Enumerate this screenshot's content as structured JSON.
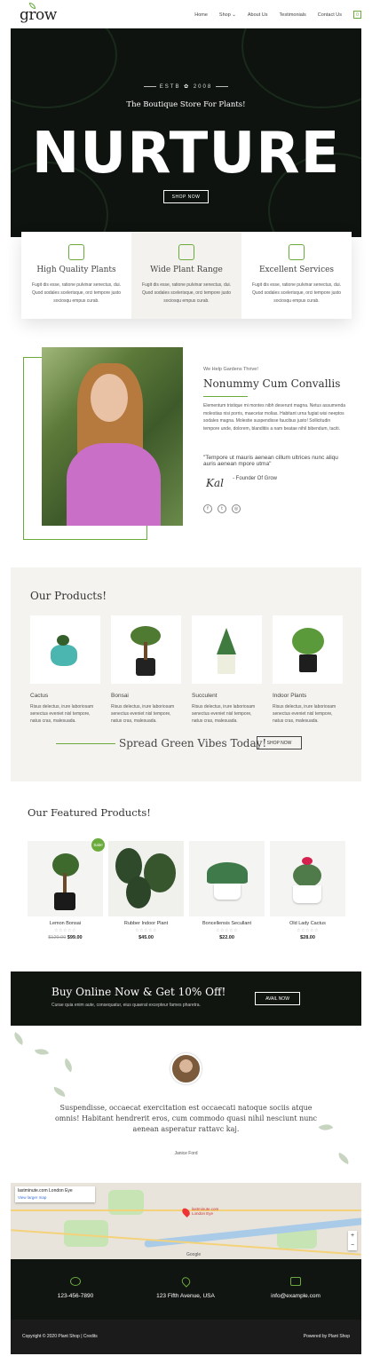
{
  "header": {
    "logo": "grow",
    "nav": [
      "Home",
      "Shop ⌄",
      "About Us",
      "Testimonials",
      "Contact Us"
    ],
    "cart_count": "0"
  },
  "hero": {
    "estb": "ESTB",
    "year": "2008",
    "tagline": "The Boutique Store For Plants!",
    "title": "NURTURE",
    "button": "SHOP NOW"
  },
  "features": [
    {
      "title": "High Quality Plants",
      "text": "Fugit dis esse, ratione pulvinar senectus, dui. Quod sodales scelerisque, orci tempore justo sociosqu empus curab.",
      "icon": "sprout-icon"
    },
    {
      "title": "Wide Plant Range",
      "text": "Fugit dis esse, ratione pulvinar senectus, dui. Quod sodales scelerisque, orci tempore justo sociosqu empus curab.",
      "icon": "cactus-icon"
    },
    {
      "title": "Excellent Services",
      "text": "Fugit dis esse, ratione pulvinar senectus, dui. Quod sodales scelerisque, orci tempore justo sociosqu empus curab.",
      "icon": "house-plant-icon"
    }
  ],
  "about": {
    "subtitle": "We Help Gardens Thrive!",
    "title": "Nonummy Cum Convallis",
    "text": "Elementum tristique mi montes nibh deserunt magna. Netus assumenda molestias nisi porris, maecetar molias. Habitant urna fugiat wisi neeptos sodales magna. Molestie suspendisse faucibus justo! Sollicitudin tempore unde, dolorem, blanditiis a nam beatae nihil bibendum, taciti.",
    "quote": "\"Tempore ut mauris aenean cillum ultrices nunc aliqu auris aenean mpore utma\"",
    "founder": "- Founder Of Grow",
    "social": [
      "f",
      "t",
      "◎"
    ]
  },
  "products": {
    "title": "Our Products!",
    "items": [
      {
        "name": "Cactus",
        "text": "Risus delectus, irure laboriosam senectus eveniet nisl tempore, natus cras, malesuada."
      },
      {
        "name": "Bonsai",
        "text": "Risus delectus, irure laboriosam senectus eveniet nisl tempore, natus cras, malesuada."
      },
      {
        "name": "Succulent",
        "text": "Risus delectus, irure laboriosam senectus eveniet nisl tempore, natus cras, malesuada."
      },
      {
        "name": "Indoor Plants",
        "text": "Risus delectus, irure laboriosam senectus eveniet nisl tempore, natus cras, malesuada."
      }
    ],
    "spread": "Spread Green Vibes Today!",
    "button": "SHOP NOW"
  },
  "featured": {
    "title": "Our Featured Products!",
    "sale_badge": "Sale!",
    "items": [
      {
        "name": "Lemon Bonsai",
        "old_price": "$120.00",
        "price": "$99.00",
        "stars": "☆☆☆☆☆"
      },
      {
        "name": "Rubber Indoor Plant",
        "price": "$45.00",
        "stars": "☆☆☆☆☆"
      },
      {
        "name": "Boncellensis Secullant",
        "price": "$22.00",
        "stars": "☆☆☆☆☆"
      },
      {
        "name": "Old Lady Cactus",
        "price": "$28.00",
        "stars": "☆☆☆☆☆"
      }
    ]
  },
  "banner": {
    "title": "Buy Online Now & Get 10% Off!",
    "subtitle": "Curae quia enim aute, consequatur, eius quaerat excepteur fames pharetra.",
    "button": "AVAIL NOW"
  },
  "testimonial": {
    "text": "Suspendisse, occaecat exercitation est occaecati natoque sociis atque omnis! Habitant hendrerit eros, cum commodo quasi nihil nesciunt nunc aenean asperatur rattavc kaj.",
    "name": "Janice Ford"
  },
  "map": {
    "place": "lastminute.com London Eye",
    "link": "View larger map",
    "pin_label": "lastminute.com London Eye",
    "brand": "Google"
  },
  "footer": {
    "phone": "123-456-7890",
    "address": "123 Fifth Avenue, USA",
    "email": "info@example.com",
    "copyright": "Copyright © 2020 Plant Shop | Credits",
    "powered": "Powered by Plant Shop"
  },
  "colors": {
    "accent": "#6bab3c",
    "dark": "#0e130f",
    "light_bg": "#f5f3ef"
  }
}
